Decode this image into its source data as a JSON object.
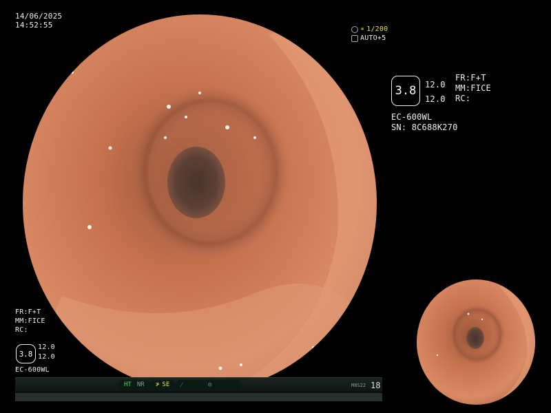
{
  "osd": {
    "date": "14/06/2025",
    "time": "14:52:55",
    "shutter_value": "1/200",
    "shutter_prefix": "∗",
    "iris": "AUTO+5",
    "right_panel": {
      "structure_value": "3.8",
      "enhance_top": "12.0",
      "enhance_bottom": "12.0",
      "fr": "FR:F+T",
      "mm": "MM:FICE",
      "rc": "RC:",
      "scope_model": "EC-600WL",
      "serial": "SN: 8C688K270"
    },
    "left_panel": {
      "fr": "FR:F+T",
      "mm": "MM:FICE",
      "rc": "RC:",
      "structure_value": "3.8",
      "enhance_top": "12.0",
      "enhance_bottom": "12.0",
      "scope_model": "EC-600WL"
    },
    "statusbar": {
      "ht": "HT",
      "nr": "NR",
      "se": "SE",
      "code": "M8S22",
      "count": "18"
    }
  },
  "colors": {
    "mucosa": "#c86a4a",
    "osd_green": "#4ad36a",
    "osd_yellow": "#e3e042"
  }
}
